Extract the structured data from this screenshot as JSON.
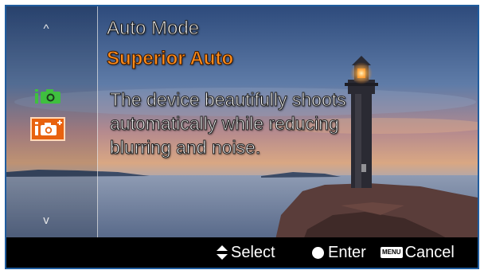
{
  "menu": {
    "title": "Auto Mode",
    "selected_option": "Superior Auto",
    "description_lines": [
      "The device beautifully shoots",
      "automatically while reducing",
      "blurring and noise."
    ],
    "scroll_up_glyph": "^",
    "scroll_down_glyph": "v",
    "mode_icons": [
      {
        "name": "intelligent-auto-icon",
        "selected": false
      },
      {
        "name": "superior-auto-icon",
        "selected": true
      }
    ]
  },
  "footer": {
    "select_label": "Select",
    "enter_label": "Enter",
    "menu_badge": "MENU",
    "cancel_label": "Cancel"
  },
  "colors": {
    "accent_orange": "#ff8c1a",
    "selected_icon_bg": "#e8620f",
    "green_icon": "#3fbf3f",
    "frame_border": "#1f5c9e",
    "footer_bg": "#000000"
  }
}
